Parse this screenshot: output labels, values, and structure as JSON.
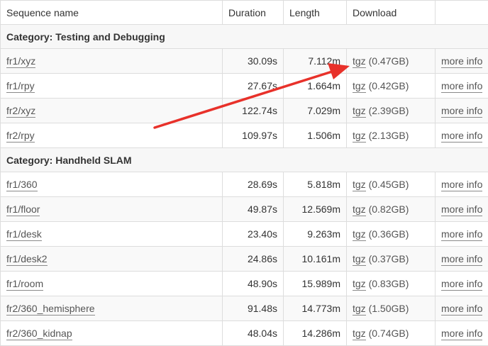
{
  "header": {
    "sequence_name": "Sequence name",
    "duration": "Duration",
    "length": "Length",
    "download": "Download",
    "extra": ""
  },
  "categories": [
    {
      "title": "Category: Testing and Debugging",
      "rows": [
        {
          "name": "fr1/xyz",
          "duration": "30.09s",
          "length": "7.112m",
          "link": "tgz",
          "size": "(0.47GB)",
          "info": "more info"
        },
        {
          "name": "fr1/rpy",
          "duration": "27.67s",
          "length": "1.664m",
          "link": "tgz",
          "size": "(0.42GB)",
          "info": "more info"
        },
        {
          "name": "fr2/xyz",
          "duration": "122.74s",
          "length": "7.029m",
          "link": "tgz",
          "size": "(2.39GB)",
          "info": "more info"
        },
        {
          "name": "fr2/rpy",
          "duration": "109.97s",
          "length": "1.506m",
          "link": "tgz",
          "size": "(2.13GB)",
          "info": "more info"
        }
      ]
    },
    {
      "title": "Category: Handheld SLAM",
      "rows": [
        {
          "name": "fr1/360",
          "duration": "28.69s",
          "length": "5.818m",
          "link": "tgz",
          "size": "(0.45GB)",
          "info": "more info"
        },
        {
          "name": "fr1/floor",
          "duration": "49.87s",
          "length": "12.569m",
          "link": "tgz",
          "size": "(0.82GB)",
          "info": "more info"
        },
        {
          "name": "fr1/desk",
          "duration": "23.40s",
          "length": "9.263m",
          "link": "tgz",
          "size": "(0.36GB)",
          "info": "more info"
        },
        {
          "name": "fr1/desk2",
          "duration": "24.86s",
          "length": "10.161m",
          "link": "tgz",
          "size": "(0.37GB)",
          "info": "more info"
        },
        {
          "name": "fr1/room",
          "duration": "48.90s",
          "length": "15.989m",
          "link": "tgz",
          "size": "(0.83GB)",
          "info": "more info"
        },
        {
          "name": "fr2/360_hemisphere",
          "duration": "91.48s",
          "length": "14.773m",
          "link": "tgz",
          "size": "(1.50GB)",
          "info": "more info"
        },
        {
          "name": "fr2/360_kidnap",
          "duration": "48.04s",
          "length": "14.286m",
          "link": "tgz",
          "size": "(0.74GB)",
          "info": "more info"
        }
      ]
    }
  ],
  "annotation": {
    "arrow_color": "#e8312a",
    "icon": "red-arrow-icon"
  }
}
